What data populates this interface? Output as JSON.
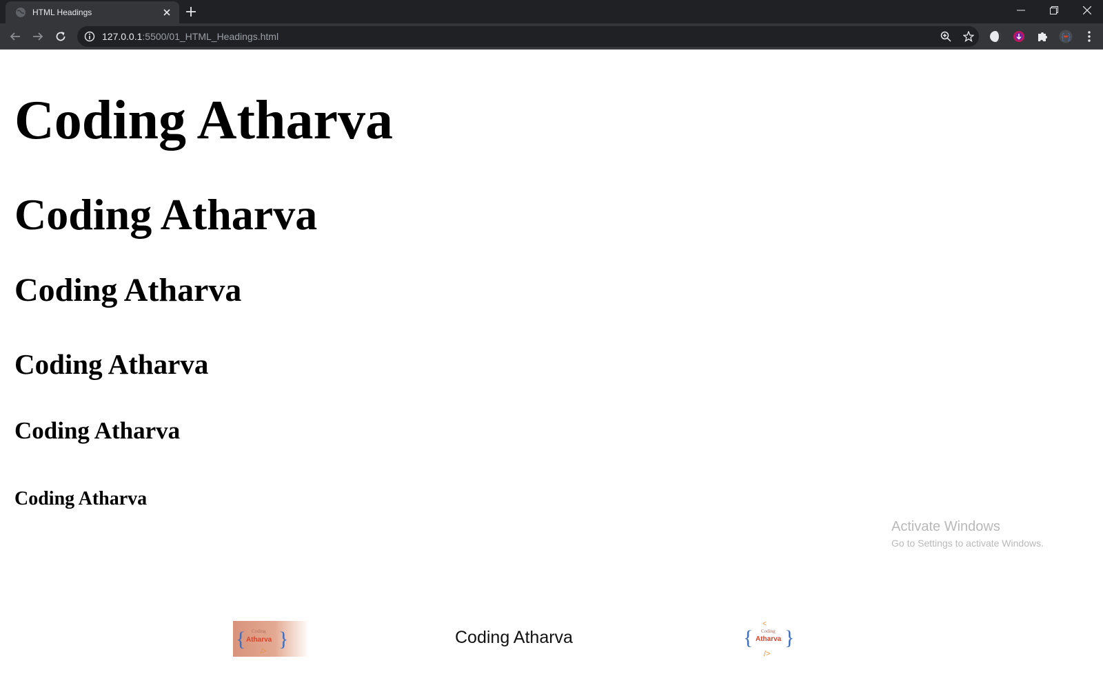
{
  "browser": {
    "tab_title": "HTML Headings",
    "url_host": "127.0.0.1",
    "url_rest": ":5500/01_HTML_Headings.html"
  },
  "page": {
    "headings": {
      "h1": "Coding Atharva",
      "h2": "Coding Atharva",
      "h3": "Coding Atharva",
      "h4": "Coding Atharva",
      "h5": "Coding Atharva",
      "h6": "Coding Atharva"
    },
    "footer": {
      "text": "Coding Atharva",
      "logo_small_text": "Coding",
      "logo_main_text": "Atharva"
    }
  },
  "watermark": {
    "title": "Activate Windows",
    "subtitle": "Go to Settings to activate Windows."
  },
  "colors": {
    "chrome_dark": "#202124",
    "chrome_toolbar": "#35363a",
    "logo_red": "#d9442a",
    "logo_blue": "#3d6fbf",
    "logo_orange": "#e8913a"
  }
}
